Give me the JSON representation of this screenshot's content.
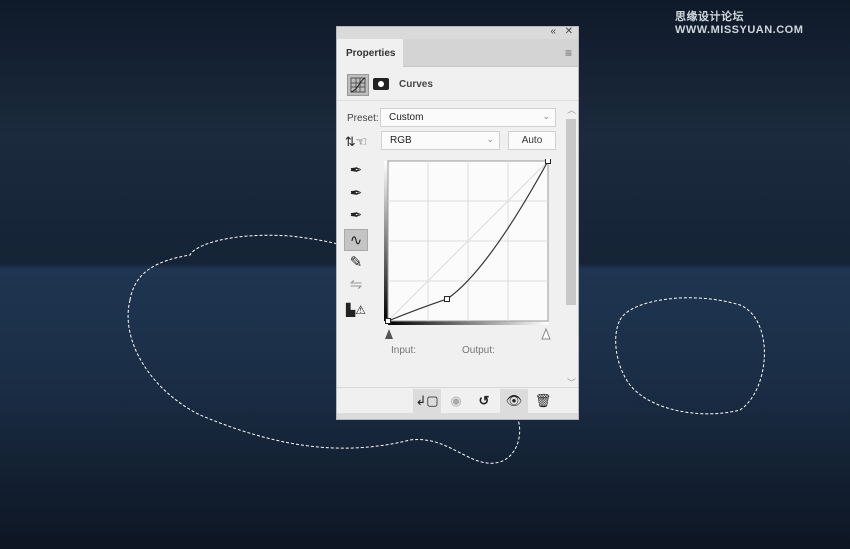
{
  "watermark": {
    "cn": "思缘设计论坛",
    "url": "WWW.MISSYUAN.COM"
  },
  "panel": {
    "collapse_icon": "double-chevron-left-icon",
    "close_icon": "close-icon",
    "tab": "Properties",
    "menu_icon": "hamburger-menu-icon",
    "adjustment_title": "Curves",
    "preset_label": "Preset:",
    "preset_value": "Custom",
    "channel_value": "RGB",
    "auto_label": "Auto",
    "input_label": "Input:",
    "output_label": "Output:",
    "tools": [
      "target-adjust-icon",
      "black-point-eyedropper-icon",
      "gray-point-eyedropper-icon",
      "white-point-eyedropper-icon",
      "curve-points-icon",
      "pencil-icon",
      "smooth-icon",
      "clipping-warning-icon"
    ],
    "active_tool": "curve-points-icon",
    "footer": [
      "clip-to-layer-icon",
      "view-previous-icon",
      "reset-icon",
      "visibility-eye-icon",
      "trash-icon"
    ]
  },
  "curve": {
    "channel": "RGB",
    "points": [
      [
        0,
        0
      ],
      [
        94,
        35
      ],
      [
        255,
        255
      ]
    ],
    "range": [
      0,
      255
    ]
  }
}
